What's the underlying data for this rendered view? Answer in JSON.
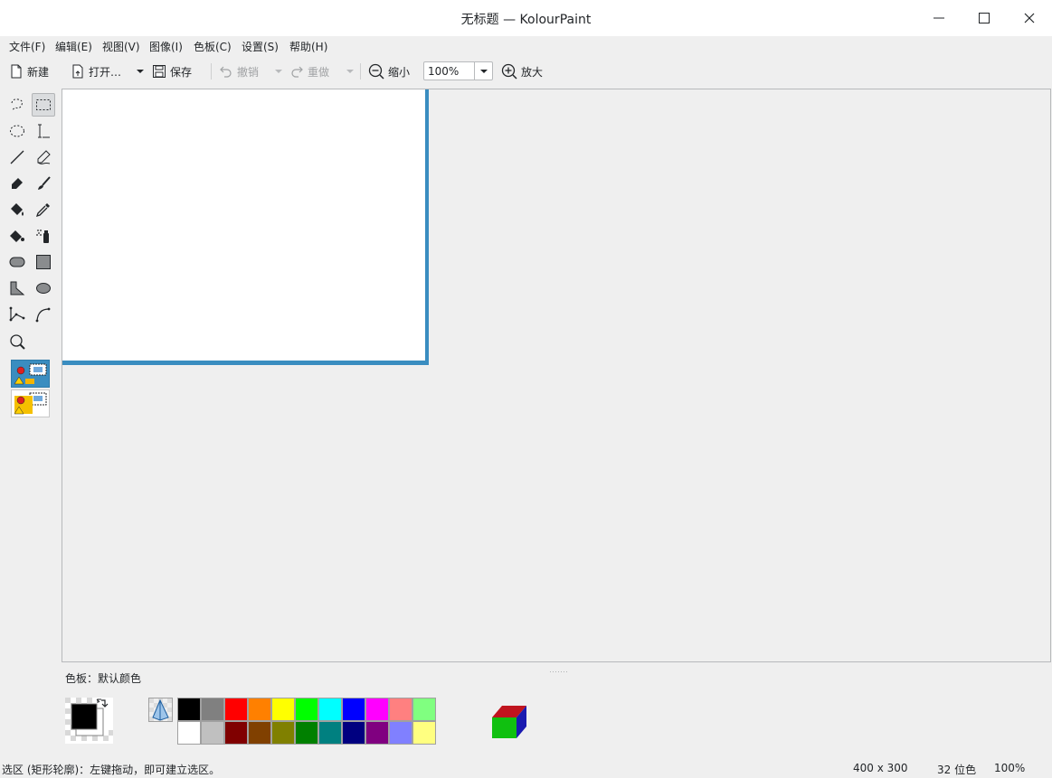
{
  "window": {
    "title": "无标题 — KolourPaint"
  },
  "menu": [
    "文件(F)",
    "编辑(E)",
    "视图(V)",
    "图像(I)",
    "色板(C)",
    "设置(S)",
    "帮助(H)"
  ],
  "toolbar": {
    "new_label": "新建",
    "open_label": "打开…",
    "save_label": "保存",
    "undo_label": "撤销",
    "redo_label": "重做",
    "zoom_out_label": "缩小",
    "zoom_value": "100%",
    "zoom_in_label": "放大"
  },
  "palette": {
    "label": "色板：默认颜色",
    "foreground": "#000000",
    "background": "#ffffff",
    "row1": [
      "#000000",
      "#808080",
      "#ff0000",
      "#ff8000",
      "#ffff00",
      "#00ff00",
      "#00ffff",
      "#0000ff",
      "#ff00ff",
      "#ff8080",
      "#80ff80"
    ],
    "row2": [
      "#ffffff",
      "#c0c0c0",
      "#800000",
      "#804000",
      "#808000",
      "#008000",
      "#008080",
      "#000080",
      "#800080",
      "#8080ff",
      "#ffff80"
    ]
  },
  "status": {
    "message": "选区 (矩形轮廓)：左键拖动，即可建立选区。",
    "size": "400 x 300",
    "depth": "32 位色",
    "zoom": "100%"
  },
  "colors": {
    "accent": "#3a8dc0"
  }
}
